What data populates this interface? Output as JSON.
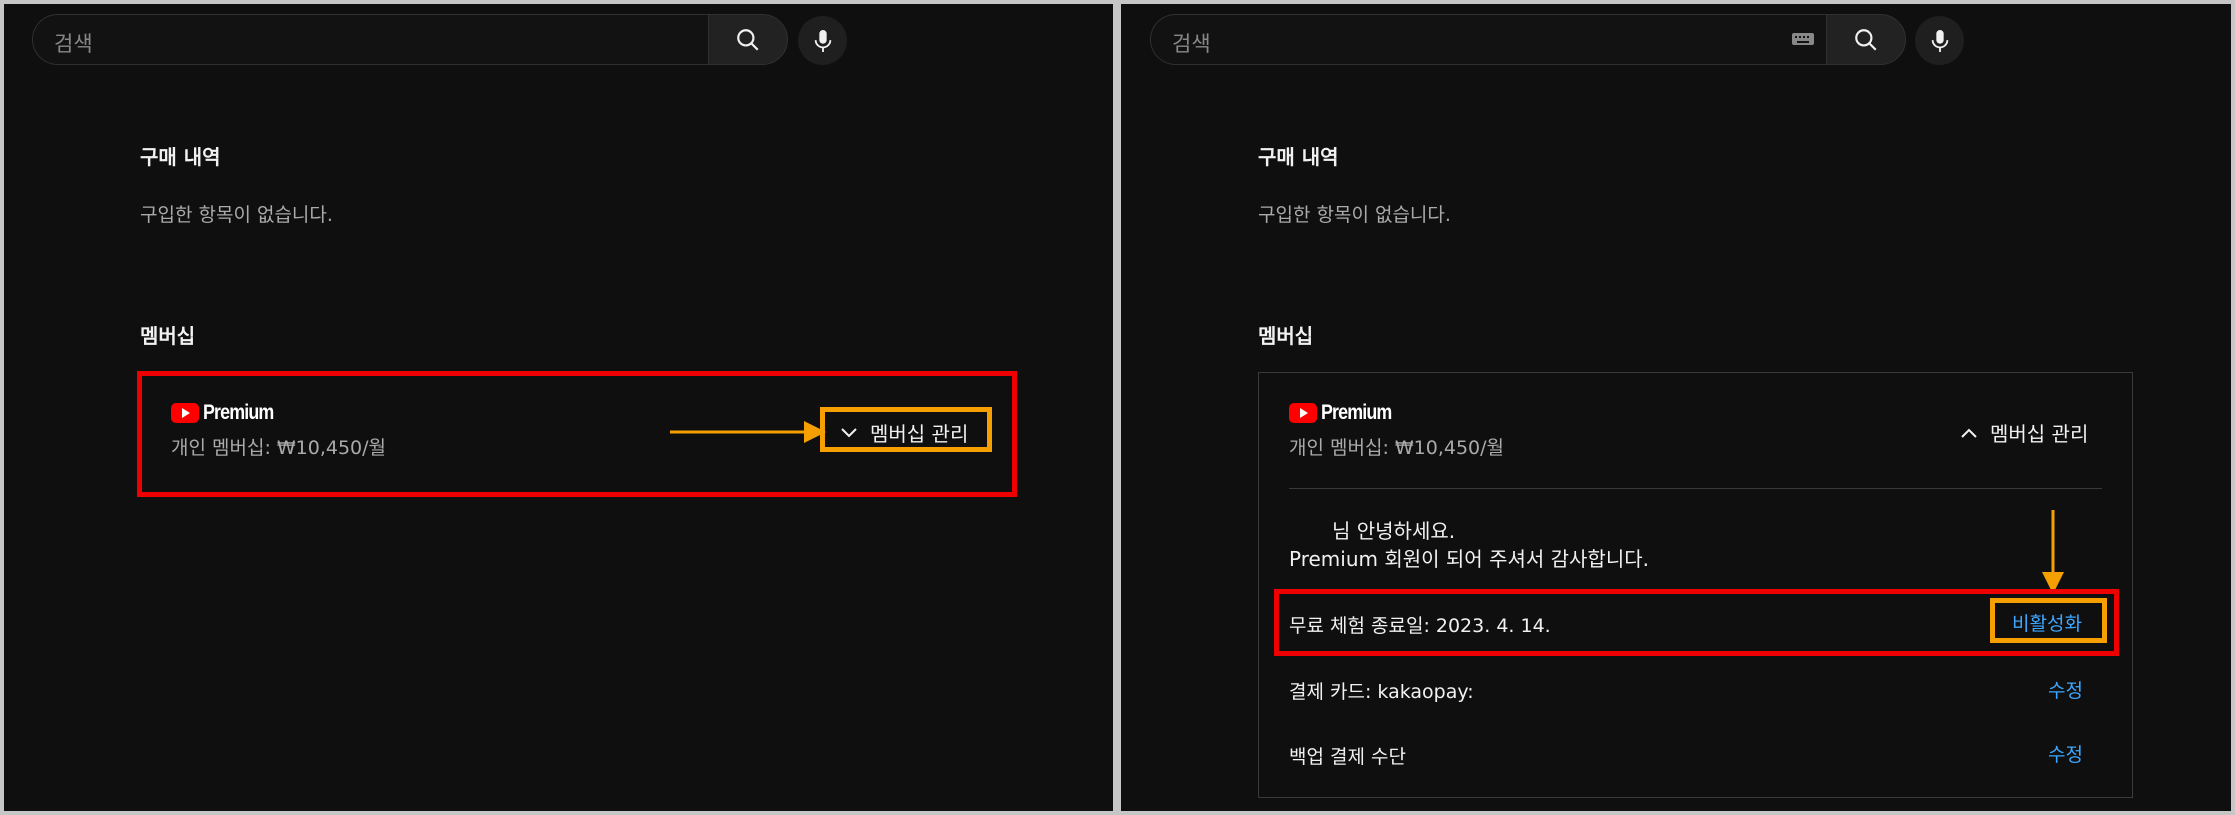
{
  "left": {
    "search": {
      "placeholder": "검색"
    },
    "purchases": {
      "title": "구매 내역",
      "empty": "구입한 항목이 없습니다."
    },
    "membership": {
      "title": "멤버십",
      "brand": "Premium",
      "plan": "개인 멤버십: ₩10,450/월",
      "manage_label": "멤버십 관리"
    }
  },
  "right": {
    "search": {
      "placeholder": "검색"
    },
    "purchases": {
      "title": "구매 내역",
      "empty": "구입한 항목이 없습니다."
    },
    "membership": {
      "title": "멤버십",
      "brand": "Premium",
      "plan": "개인 멤버십: ₩10,450/월",
      "manage_label": "멤버십 관리",
      "greeting": "님 안녕하세요.",
      "thanks": "Premium 회원이 되어 주셔서 감사합니다.",
      "trial_end": "무료 체험 종료일: 2023. 4. 14.",
      "deactivate_label": "비활성화",
      "payment_card": "결제 카드: kakaopay:",
      "backup_payment": "백업 결제 수단",
      "edit_label": "수정"
    }
  },
  "colors": {
    "background": "#0f0f0f",
    "highlight_red": "#ee0000",
    "highlight_orange": "#f5a000",
    "link_blue": "#3ea6ff",
    "brand_red": "#ff0000"
  },
  "icons": [
    "search-icon",
    "mic-icon",
    "keyboard-icon",
    "youtube-logo-icon",
    "chevron-down-icon",
    "chevron-up-icon",
    "arrow-right-icon",
    "arrow-down-icon"
  ]
}
